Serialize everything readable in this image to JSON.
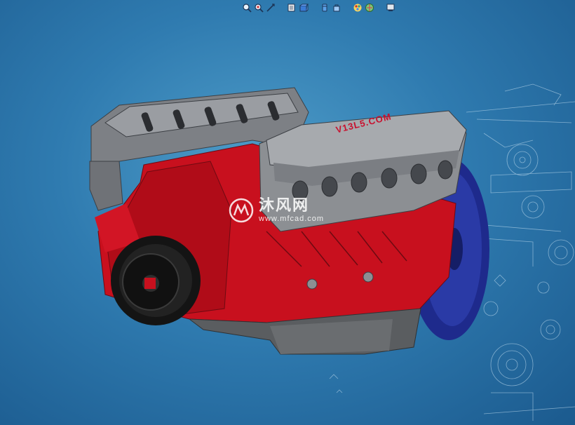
{
  "viewport": {
    "background_color": "#2f7bb0",
    "engine_cover_label": "V13L5.COM"
  },
  "toolbar": {
    "buttons": [
      {
        "icon": "zoom-to-fit-icon"
      },
      {
        "icon": "zoom-to-area-icon"
      },
      {
        "icon": "rotate-view-icon"
      },
      {
        "icon": "section-view-icon"
      },
      {
        "icon": "view-orientation-icon"
      },
      {
        "icon": "display-style-icon"
      },
      {
        "icon": "hide-show-items-icon"
      },
      {
        "icon": "edit-appearance-icon"
      },
      {
        "icon": "apply-scene-icon"
      },
      {
        "icon": "view-settings-icon"
      }
    ]
  },
  "watermark": {
    "chinese_text": "沐风网",
    "url_text": "www.mfcad.com"
  },
  "colors": {
    "engine_block": "#c8101e",
    "cylinder_heads": "#8c8f93",
    "flywheel": "#1e2a8c",
    "pulley": "#141414",
    "oil_pan": "#5a5d60"
  }
}
